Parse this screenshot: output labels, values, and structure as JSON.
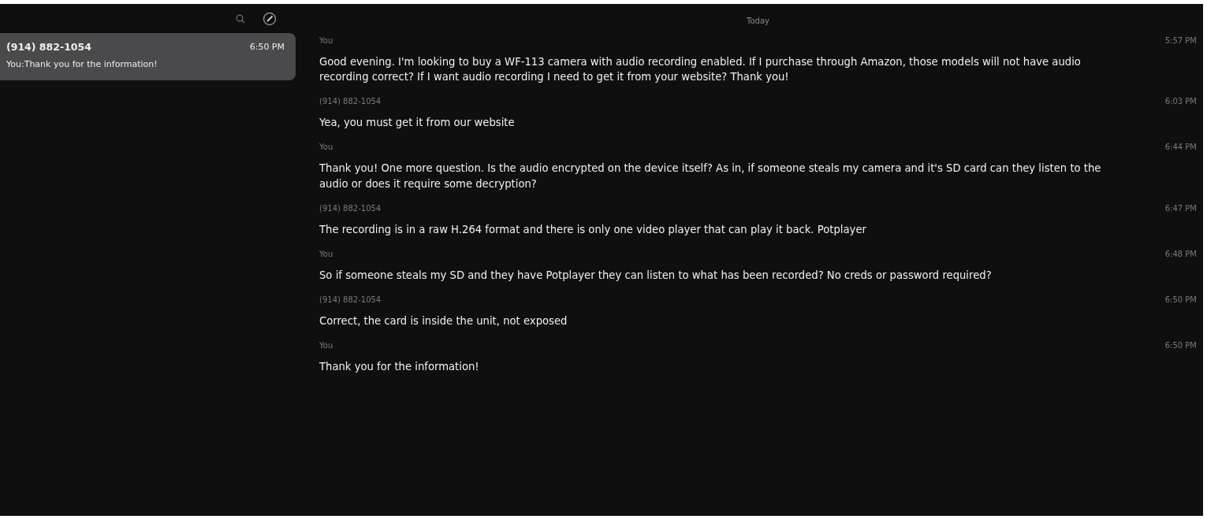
{
  "sidebar": {
    "conversations": [
      {
        "name": "(914) 882-1054",
        "time": "6:50 PM",
        "preview": "You:Thank you for the information!",
        "selected": true
      }
    ]
  },
  "thread": {
    "date_header": "Today",
    "messages": [
      {
        "sender": "You",
        "time": "5:57 PM",
        "text": "Good evening.  I'm looking to buy a WF-113 camera with audio recording enabled.  If I purchase through Amazon, those models will not have audio recording correct?  If I want audio recording I need to get it from your website?  Thank you!"
      },
      {
        "sender": "(914) 882-1054",
        "time": "6:03 PM",
        "text": "Yea, you must get it from our website"
      },
      {
        "sender": "You",
        "time": "6:44 PM",
        "text": "Thank you!  One more question.  Is the audio encrypted on the device itself?  As in, if someone steals my camera and it's SD card can they listen to the audio or does it require some decryption?"
      },
      {
        "sender": "(914) 882-1054",
        "time": "6:47 PM",
        "text": "The recording is in a raw H.264 format and there is only one video player that can play it back. Potplayer"
      },
      {
        "sender": "You",
        "time": "6:48 PM",
        "text": "So if someone steals my SD and they have Potplayer they can listen to what has been recorded?  No creds or password required?"
      },
      {
        "sender": "(914) 882-1054",
        "time": "6:50 PM",
        "text": "Correct, the card is inside the unit, not exposed"
      },
      {
        "sender": "You",
        "time": "6:50 PM",
        "text": "Thank you for the information!"
      }
    ]
  }
}
